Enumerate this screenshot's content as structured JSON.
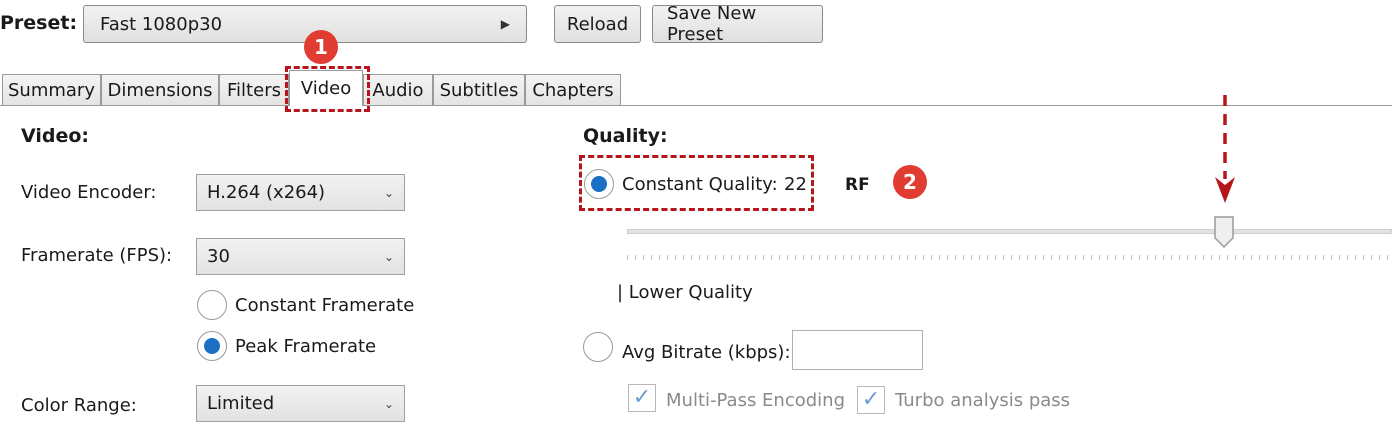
{
  "toolbar": {
    "preset_label": "Preset:",
    "preset_value": "Fast 1080p30",
    "reload_label": "Reload",
    "save_new_label": "Save New Preset"
  },
  "tabs": [
    {
      "label": "Summary"
    },
    {
      "label": "Dimensions"
    },
    {
      "label": "Filters"
    },
    {
      "label": "Video",
      "active": true
    },
    {
      "label": "Audio"
    },
    {
      "label": "Subtitles"
    },
    {
      "label": "Chapters"
    }
  ],
  "annotations": {
    "badge1": "1",
    "badge2": "2",
    "accent_color": "#b5151b"
  },
  "video": {
    "title": "Video:",
    "encoder_label": "Video Encoder:",
    "encoder_value": "H.264 (x264)",
    "framerate_label": "Framerate (FPS):",
    "framerate_value": "30",
    "constant_framerate": "Constant Framerate",
    "peak_framerate": "Peak Framerate",
    "color_range_label": "Color Range:",
    "color_range_value": "Limited"
  },
  "quality": {
    "title": "Quality:",
    "constant_quality_label": "Constant Quality:",
    "constant_quality_value": "22",
    "rf_label": "RF",
    "slider_value": 22,
    "lower_quality": "| Lower Quality",
    "avg_bitrate_label": "Avg Bitrate (kbps):",
    "avg_bitrate_value": "",
    "multipass": "Multi-Pass Encoding",
    "turbo": "Turbo analysis pass"
  }
}
